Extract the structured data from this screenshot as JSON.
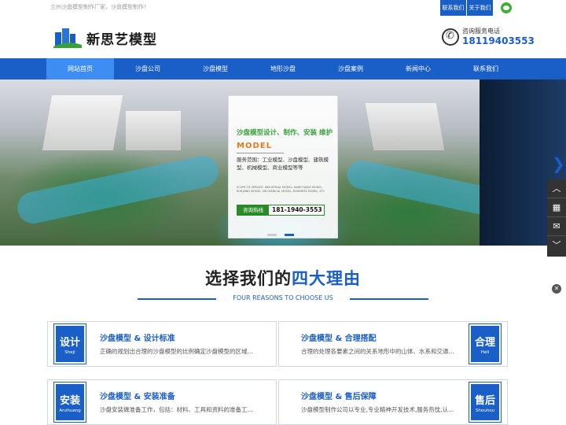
{
  "topbar": {
    "tagline": "兰州沙盘模型制作厂家，沙盘模型制作！",
    "links": [
      "联系我们",
      "关于我们"
    ]
  },
  "header": {
    "brand": "新思艺模型",
    "hotline_label": "咨询服务电话",
    "hotline_number": "18119403553"
  },
  "nav": {
    "items": [
      "网站首页",
      "沙盘公司",
      "沙盘模型",
      "地形沙盘",
      "沙盘案例",
      "新闻中心",
      "联系我们"
    ],
    "active_index": 0
  },
  "banner": {
    "card_title": "沙盘模型设计、制作、安装 维护",
    "card_model": "MODEL",
    "card_scope": "服务范围：工业模型、沙盘模型、建筑模型、机械模型、商业模型等等",
    "card_en": "SCOPE OF SERVICE: INDUSTRIAL MODEL, SAND TABLE MODEL, BUILDING MODEL, MECHANICAL MODEL, BUSINESS MODEL, ETC",
    "hotline_label": "咨询热线",
    "hotline_number": "181-1940-3553",
    "active_slide": 2,
    "slide_count": 2
  },
  "float_icons": [
    "chevron-up-icon",
    "qrcode-icon",
    "wechat-icon",
    "chevron-down-icon"
  ],
  "reasons": {
    "title_prefix": "选择我们的",
    "title_highlight": "四大理由",
    "subtitle": "FOUR REASONS TO CHOOSE US",
    "items": [
      {
        "badge_cn": "设计",
        "badge_en": "Sheji",
        "title": "沙盘模型 & 设计标准",
        "desc": "正确的规划出合理的沙盘模型的比例确定沙盘模型的区域..."
      },
      {
        "badge_cn": "合理",
        "badge_en": "Heli",
        "title": "沙盘模型 & 合理搭配",
        "desc": "合理的处理各要素之间的关系地形中的山体、水系和交通..."
      },
      {
        "badge_cn": "安装",
        "badge_en": "Anzhuang",
        "title": "沙盘模型 & 安装准备",
        "desc": "沙盘安装做准备工作，包括：材料、工具和资料的准备工..."
      },
      {
        "badge_cn": "售后",
        "badge_en": "Shouhou",
        "title": "沙盘模型 & 售后保障",
        "desc": "沙盘模型制作公司以专业,专业精神开发技术,服务热忱,认..."
      }
    ]
  },
  "colors": {
    "primary": "#1a5ec7",
    "nav_active": "#3d8df2",
    "green": "#3aa03a"
  }
}
